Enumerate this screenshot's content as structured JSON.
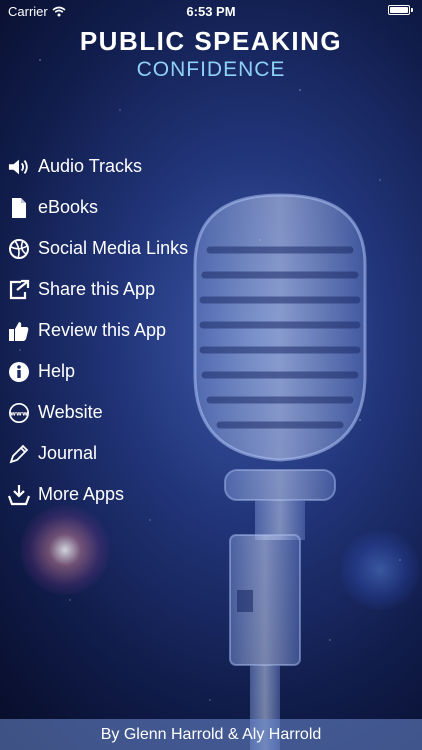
{
  "status_bar": {
    "carrier": "Carrier",
    "time": "6:53 PM"
  },
  "header": {
    "title": "PUBLIC SPEAKING",
    "subtitle": "CONFIDENCE"
  },
  "menu": {
    "items": [
      {
        "label": "Audio Tracks",
        "icon": "speaker-icon"
      },
      {
        "label": "eBooks",
        "icon": "document-icon"
      },
      {
        "label": "Social Media Links",
        "icon": "globe-ball-icon"
      },
      {
        "label": "Share this App",
        "icon": "share-icon"
      },
      {
        "label": "Review this App",
        "icon": "thumbs-up-icon"
      },
      {
        "label": "Help",
        "icon": "info-icon"
      },
      {
        "label": "Website",
        "icon": "www-icon"
      },
      {
        "label": "Journal",
        "icon": "pencil-icon"
      },
      {
        "label": "More Apps",
        "icon": "download-tray-icon"
      }
    ]
  },
  "footer": {
    "credit": "By Glenn Harrold & Aly Harrold"
  },
  "colors": {
    "subtitle": "#8fd0f5",
    "background_deep": "#101c4a",
    "footer_bar": "#6e8cd2"
  }
}
